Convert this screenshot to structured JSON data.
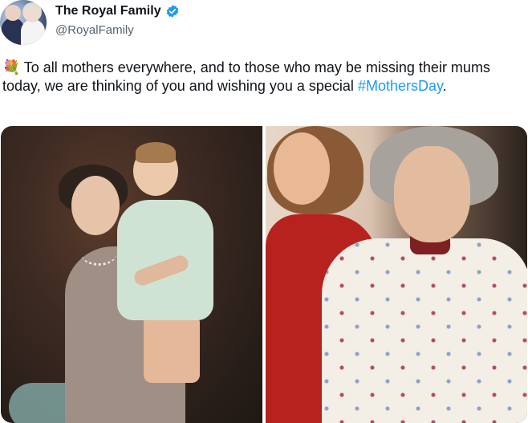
{
  "author": {
    "display_name": "The Royal Family",
    "handle": "@RoyalFamily",
    "verified": true,
    "avatar_icon": "royal-couple-avatar"
  },
  "tweet": {
    "leading_emoji": "💐",
    "text": "To all mothers everywhere, and to those who may be missing their mums today, we are thinking of you and wishing you a special ",
    "hashtag": "#MothersDay",
    "trailing": "."
  },
  "colors": {
    "hashtag": "#1d9bf0",
    "verified_badge": "#1d9bf0",
    "text": "#0f1419",
    "handle": "#536471"
  },
  "media": {
    "count": 2,
    "images": [
      "photo-mother-with-child",
      "photo-two-women"
    ]
  }
}
